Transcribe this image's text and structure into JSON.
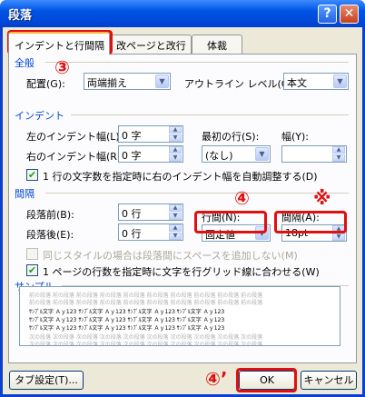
{
  "window": {
    "title": "段落",
    "help": "?",
    "close": "✕"
  },
  "tabs": [
    {
      "label": "インデントと行間隔"
    },
    {
      "label": "改ページと改行"
    },
    {
      "label": "体裁"
    }
  ],
  "general": {
    "title": "全般",
    "alignment_label": "配置(G):",
    "alignment_value": "両端揃え",
    "outline_label": "アウトライン レベル(O):",
    "outline_value": "本文"
  },
  "indent": {
    "title": "インデント",
    "left_label": "左のインデント幅(L):",
    "left_value": "0 字",
    "right_label": "右のインデント幅(R):",
    "right_value": "0 字",
    "first_label": "最初の行(S):",
    "first_value": "(なし)",
    "width_label": "幅(Y):",
    "width_value": "",
    "auto_adjust_label": "1 行の文字数を指定時に右のインデント幅を自動調整する(D)",
    "auto_adjust_checked": true
  },
  "spacing": {
    "title": "間隔",
    "before_label": "段落前(B):",
    "before_value": "0 行",
    "after_label": "段落後(E):",
    "after_value": "0 行",
    "line_label": "行間(N):",
    "line_value": "固定値",
    "at_label": "間隔(A):",
    "at_value": "18pt",
    "no_space_label": "同じスタイルの場合は段落間にスペースを追加しない(M)",
    "no_space_checked": false,
    "grid_label": "1 ページの行数を指定時に文字を行グリッド線に合わせる(W)",
    "grid_checked": true
  },
  "sample": {
    "title": "サンプル",
    "prev_text": "前の段落 前の段落 前の段落 前の段落 前の段落 前の段落 前の段落 前の段落 前の段落 前の段落",
    "text": "ｻﾝﾌﾟﾙ文字 Ａｙ123 ｻﾝﾌﾟﾙ文字 Ａｙ123 ｻﾝﾌﾟﾙ文字 Ａｙ123 ｻﾝﾌﾟﾙ文字 Ａｙ123",
    "next_text": "次の段落 次の段落 次の段落 次の段落 次の段落 次の段落 次の段落 次の段落 次の段落 次の段落"
  },
  "buttons": {
    "tabs": "タブ設定(T)...",
    "ok": "OK",
    "cancel": "キャンセル"
  },
  "annotations": {
    "tab_mark": "③",
    "line_mark": "④",
    "at_mark": "※",
    "ok_mark": "④’"
  }
}
